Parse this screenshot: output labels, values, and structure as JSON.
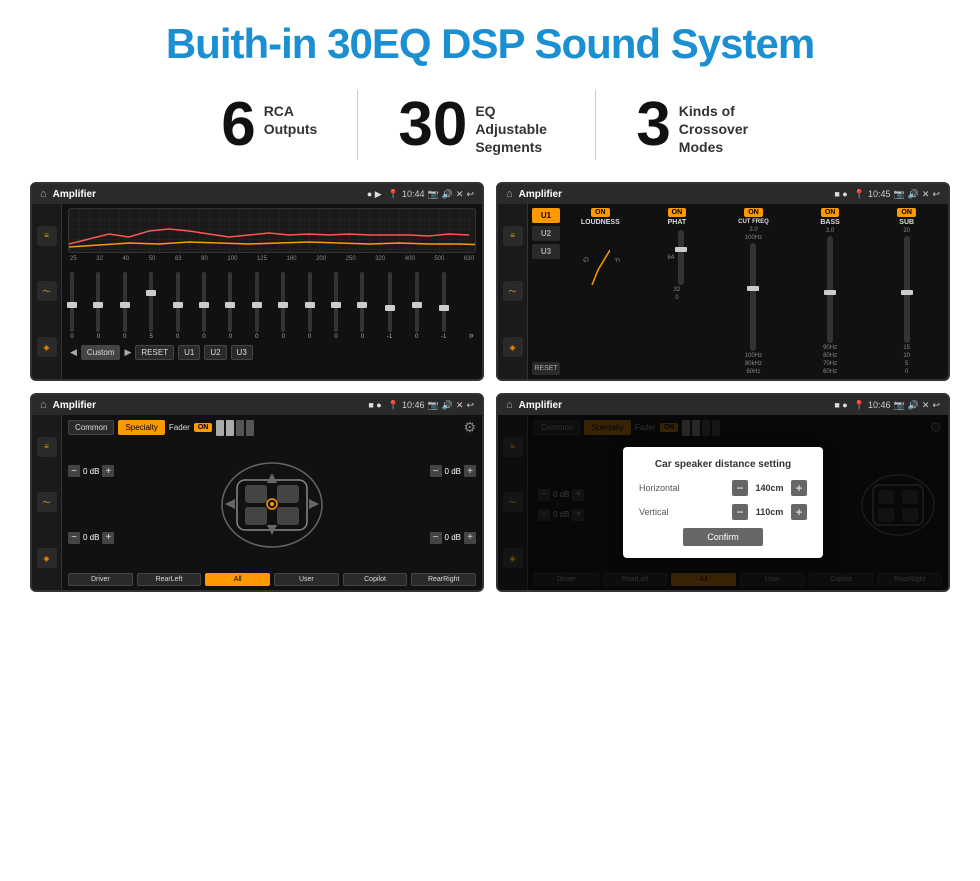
{
  "header": {
    "title": "Buith-in 30EQ DSP Sound System"
  },
  "stats": [
    {
      "number": "6",
      "label_line1": "RCA",
      "label_line2": "Outputs"
    },
    {
      "number": "30",
      "label_line1": "EQ Adjustable",
      "label_line2": "Segments"
    },
    {
      "number": "3",
      "label_line1": "Kinds of",
      "label_line2": "Crossover Modes"
    }
  ],
  "screens": {
    "screen1": {
      "app": "Amplifier",
      "time": "10:44",
      "eq_freqs": [
        "25",
        "32",
        "40",
        "50",
        "63",
        "80",
        "100",
        "125",
        "160",
        "200",
        "250",
        "320",
        "400",
        "500",
        "630"
      ],
      "eq_vals": [
        "0",
        "0",
        "0",
        "5",
        "0",
        "0",
        "0",
        "0",
        "0",
        "0",
        "0",
        "0",
        "-1",
        "0",
        "-1"
      ],
      "preset": "Custom",
      "buttons": [
        "RESET",
        "U1",
        "U2",
        "U3"
      ]
    },
    "screen2": {
      "app": "Amplifier",
      "time": "10:45",
      "presets": [
        "U1",
        "U2",
        "U3"
      ],
      "controls": [
        "LOUDNESS",
        "PHAT",
        "CUT FREQ",
        "BASS",
        "SUB"
      ]
    },
    "screen3": {
      "app": "Amplifier",
      "time": "10:46",
      "tabs": [
        "Common",
        "Specialty"
      ],
      "fader_label": "Fader",
      "fader_on": "ON",
      "db_values": [
        "0 dB",
        "0 dB",
        "0 dB",
        "0 dB"
      ],
      "buttons": [
        "Driver",
        "RearLeft",
        "All",
        "User",
        "Copilot",
        "RearRight"
      ]
    },
    "screen4": {
      "app": "Amplifier",
      "time": "10:46",
      "tabs": [
        "Common",
        "Specialty"
      ],
      "dialog": {
        "title": "Car speaker distance setting",
        "horizontal_label": "Horizontal",
        "horizontal_value": "140cm",
        "vertical_label": "Vertical",
        "vertical_value": "110cm",
        "confirm_label": "Confirm"
      },
      "db_values": [
        "0 dB",
        "0 dB"
      ],
      "buttons": [
        "Driver",
        "RearLeft",
        "All",
        "User",
        "Copilot",
        "RearRight"
      ]
    }
  }
}
